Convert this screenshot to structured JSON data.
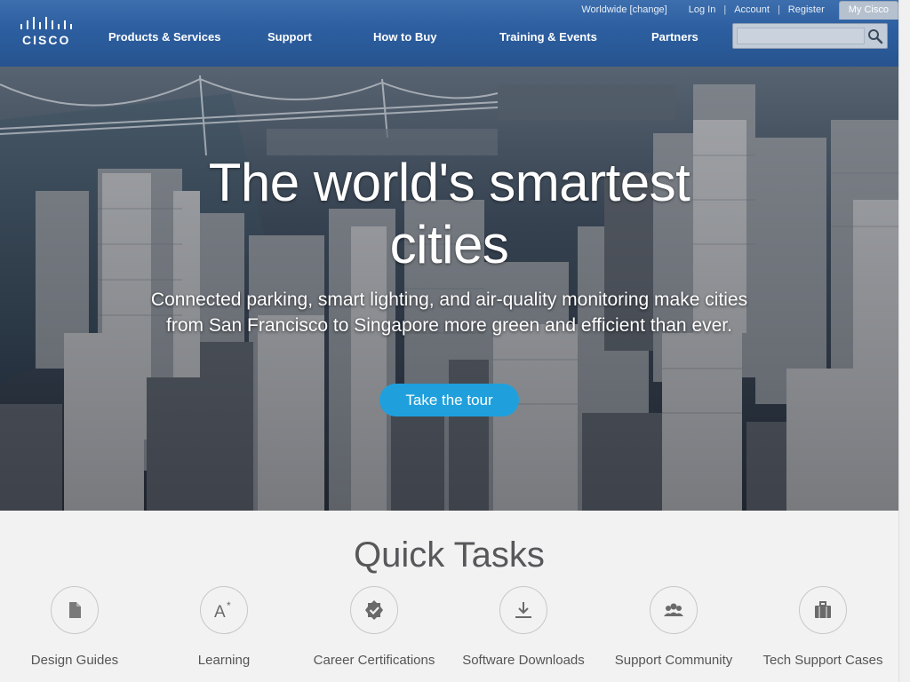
{
  "brand": {
    "logo_text": "CISCO"
  },
  "utility": {
    "worldwide": "Worldwide [change]",
    "login": "Log In",
    "account": "Account",
    "register": "Register",
    "mycisco": "My Cisco",
    "separator": "|"
  },
  "nav": {
    "items": [
      "Products & Services",
      "Support",
      "How to Buy",
      "Training & Events",
      "Partners"
    ]
  },
  "search": {
    "placeholder": "",
    "value": ""
  },
  "hero": {
    "title_line1": "The world's smartest",
    "title_line2": "cities",
    "subtitle": "Connected parking, smart lighting, and air-quality monitoring make cities from San Francisco to Singapore more green and efficient than ever.",
    "cta": "Take the tour"
  },
  "quick_tasks": {
    "title": "Quick Tasks",
    "items": [
      {
        "label": "Design Guides",
        "icon": "document-icon"
      },
      {
        "label": "Learning",
        "icon": "learning-icon"
      },
      {
        "label": "Career Certifications",
        "icon": "certification-badge-icon"
      },
      {
        "label": "Software Downloads",
        "icon": "download-icon"
      },
      {
        "label": "Support Community",
        "icon": "community-icon"
      },
      {
        "label": "Tech Support Cases",
        "icon": "briefcase-icon"
      }
    ]
  },
  "colors": {
    "header": "#2c5ea0",
    "cta": "#1fa0dd",
    "quick_bg": "#f2f2f2"
  }
}
